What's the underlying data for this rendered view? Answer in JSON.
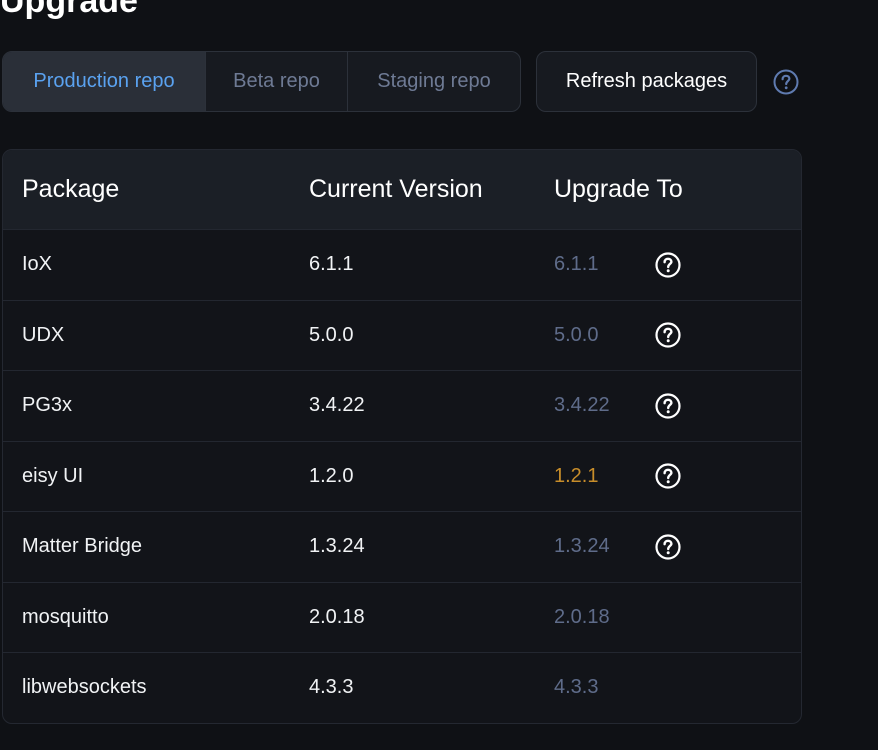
{
  "page": {
    "title": "Upgrade"
  },
  "tabs": [
    {
      "label": "Production repo",
      "active": true
    },
    {
      "label": "Beta repo",
      "active": false
    },
    {
      "label": "Staging repo",
      "active": false
    }
  ],
  "toolbar": {
    "refresh_label": "Refresh packages",
    "help_icon": "question-circle-icon"
  },
  "table": {
    "headers": {
      "package": "Package",
      "current": "Current Version",
      "upgrade": "Upgrade To"
    },
    "rows": [
      {
        "package": "IoX",
        "current": "6.1.1",
        "upgrade": "6.1.1",
        "upgrade_available": false,
        "has_help": true
      },
      {
        "package": "UDX",
        "current": "5.0.0",
        "upgrade": "5.0.0",
        "upgrade_available": false,
        "has_help": true
      },
      {
        "package": "PG3x",
        "current": "3.4.22",
        "upgrade": "3.4.22",
        "upgrade_available": false,
        "has_help": true
      },
      {
        "package": "eisy UI",
        "current": "1.2.0",
        "upgrade": "1.2.1",
        "upgrade_available": true,
        "has_help": true
      },
      {
        "package": "Matter Bridge",
        "current": "1.3.24",
        "upgrade": "1.3.24",
        "upgrade_available": false,
        "has_help": true
      },
      {
        "package": "mosquitto",
        "current": "2.0.18",
        "upgrade": "2.0.18",
        "upgrade_available": false,
        "has_help": false
      },
      {
        "package": "libwebsockets",
        "current": "4.3.3",
        "upgrade": "4.3.3",
        "upgrade_available": false,
        "has_help": false
      }
    ]
  },
  "colors": {
    "background": "#0f1115",
    "active_tab_text": "#5aa2f0",
    "inactive_tab_text": "#6e7a94",
    "upgrade_same": "#5f6c8a",
    "upgrade_available": "#c78d2a"
  }
}
